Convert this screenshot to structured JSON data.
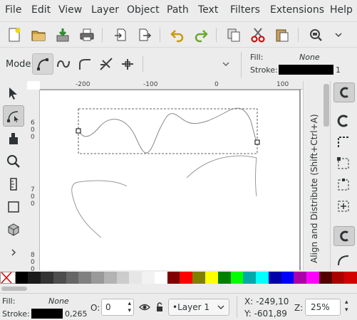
{
  "menu": [
    "File",
    "Edit",
    "View",
    "Layer",
    "Object",
    "Path",
    "Text",
    "Filters",
    "Extensions",
    "Help"
  ],
  "command_icons": [
    "new-document-icon",
    "open-icon",
    "import-icon",
    "print-icon",
    "import-arrow-icon",
    "export-icon",
    "undo-icon",
    "redo-icon",
    "duplicate-icon",
    "cut-icon",
    "paste-icon",
    "zoom-icon",
    "more-icon"
  ],
  "controls": {
    "mode_label": "Mode:",
    "fill_label": "Fill:",
    "fill_value": "None",
    "stroke_label": "Stroke:",
    "stroke_width": "1"
  },
  "tools": [
    "selector-tool-icon",
    "node-tool-icon",
    "tweak-tool-icon",
    "zoom-tool-icon",
    "measure-tool-icon",
    "rect-tool-icon",
    "3dbox-tool-icon",
    "more-tools-icon"
  ],
  "ruler": {
    "h_labels": [
      "-200",
      "-100",
      "0",
      "100"
    ],
    "v_labels": [
      "6",
      "0",
      "0",
      "7",
      "0",
      "0",
      "8",
      "0",
      "0"
    ]
  },
  "dock": {
    "panel_title": "Align and Distribute (Shift+Ctrl+A)"
  },
  "palette": [
    "#000000",
    "#1a1a1a",
    "#333333",
    "#4d4d4d",
    "#666666",
    "#808080",
    "#999999",
    "#b3b3b3",
    "#cccccc",
    "#e6e6e6",
    "#f2f2f2",
    "#ffffff",
    "#800000",
    "#ff0000",
    "#808000",
    "#ffff00",
    "#008000",
    "#00ff00",
    "#00aaaa",
    "#00ffff",
    "#0000aa",
    "#0000ff",
    "#aa00aa",
    "#ff00ff",
    "#550000",
    "#aa0000",
    "#d40000"
  ],
  "status": {
    "fill_label": "Fill:",
    "fill_value": "None",
    "stroke_label": "Stroke:",
    "stroke_width": "0,265",
    "opacity_label": "O:",
    "opacity_value": "0",
    "layer": "•Layer 1",
    "x_coord": "X: -249,10",
    "y_coord": "Y: -601,89",
    "zoom_label": "Z:",
    "zoom_value": "25%"
  }
}
